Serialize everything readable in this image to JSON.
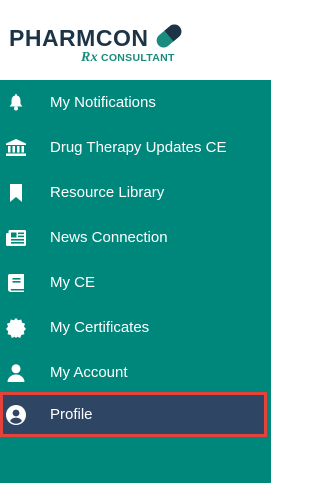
{
  "brand": {
    "name_part1": "PHARM",
    "name_part2": "CON",
    "rx": "Rx",
    "tagline": "CONSULTANT",
    "colors": {
      "navy": "#1d3447",
      "teal": "#1a8c7f"
    }
  },
  "menu": {
    "background": "#00877b",
    "active_background": "#2e4664",
    "highlight_border": "#e3433b",
    "items": [
      {
        "label": "My Notifications",
        "icon": "bell-icon"
      },
      {
        "label": "Drug Therapy Updates CE",
        "icon": "institution-icon"
      },
      {
        "label": "Resource Library",
        "icon": "bookmark-icon"
      },
      {
        "label": "News Connection",
        "icon": "newspaper-icon"
      },
      {
        "label": "My CE",
        "icon": "book-icon"
      },
      {
        "label": "My Certificates",
        "icon": "certificate-icon"
      },
      {
        "label": "My Account",
        "icon": "user-icon"
      },
      {
        "label": "Profile",
        "icon": "user-circle-icon",
        "active": true
      }
    ]
  }
}
